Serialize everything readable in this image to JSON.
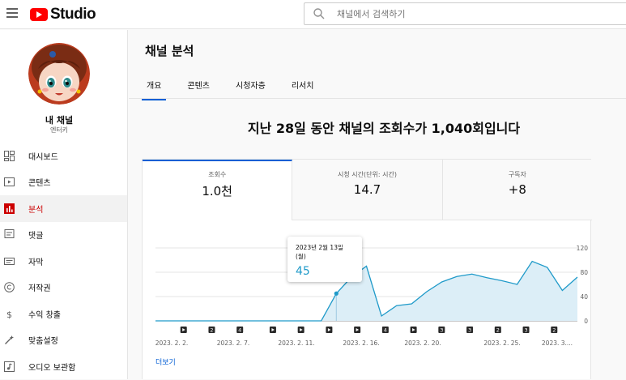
{
  "header": {
    "logo_text": "Studio",
    "search_placeholder": "채널에서 검색하기"
  },
  "sidebar": {
    "channel_name": "내 채널",
    "channel_sub": "엔터키",
    "items": [
      {
        "label": "대시보드",
        "icon": "dashboard-icon",
        "active": false
      },
      {
        "label": "콘텐츠",
        "icon": "content-icon",
        "active": false
      },
      {
        "label": "분석",
        "icon": "analytics-icon",
        "active": true
      },
      {
        "label": "댓글",
        "icon": "comments-icon",
        "active": false
      },
      {
        "label": "자막",
        "icon": "subtitles-icon",
        "active": false
      },
      {
        "label": "저작권",
        "icon": "copyright-icon",
        "active": false
      },
      {
        "label": "수익 창출",
        "icon": "monetization-icon",
        "active": false
      },
      {
        "label": "맞춤설정",
        "icon": "customization-icon",
        "active": false
      },
      {
        "label": "오디오 보관함",
        "icon": "audio-library-icon",
        "active": false
      }
    ]
  },
  "main": {
    "title": "채널 분석",
    "tabs": [
      {
        "label": "개요",
        "active": true
      },
      {
        "label": "콘텐츠",
        "active": false
      },
      {
        "label": "시청자층",
        "active": false
      },
      {
        "label": "리서치",
        "active": false
      }
    ],
    "headline": "지난 28일 동안 채널의 조회수가 1,040회입니다",
    "metrics": [
      {
        "label": "조회수",
        "value": "1.0천",
        "active": true
      },
      {
        "label": "시청 시간(단위: 시간)",
        "value": "14.7",
        "active": false
      },
      {
        "label": "구독자",
        "value": "+8",
        "active": false
      }
    ],
    "tooltip": {
      "date": "2023년 2월 13일 (월)",
      "value": "45"
    },
    "more_label": "더보기"
  },
  "colors": {
    "accent": "#065fd4",
    "chart_line": "#1f9ac9",
    "chart_fill": "#dceef7",
    "active_nav": "#cc0000"
  },
  "chart_data": {
    "type": "area",
    "x": [
      "2023. 2. 1.",
      "2023. 2. 2.",
      "2023. 2. 3.",
      "2023. 2. 4.",
      "2023. 2. 5.",
      "2023. 2. 6.",
      "2023. 2. 7.",
      "2023. 2. 8.",
      "2023. 2. 9.",
      "2023. 2. 10.",
      "2023. 2. 11.",
      "2023. 2. 12.",
      "2023. 2. 13.",
      "2023. 2. 14.",
      "2023. 2. 15.",
      "2023. 2. 16.",
      "2023. 2. 17.",
      "2023. 2. 18.",
      "2023. 2. 19.",
      "2023. 2. 20.",
      "2023. 2. 21.",
      "2023. 2. 22.",
      "2023. 2. 23.",
      "2023. 2. 24.",
      "2023. 2. 25.",
      "2023. 2. 26.",
      "2023. 2. 27.",
      "2023. 2. 28."
    ],
    "values": [
      0,
      0,
      0,
      0,
      0,
      0,
      0,
      0,
      0,
      0,
      0,
      0,
      45,
      72,
      90,
      8,
      25,
      28,
      48,
      64,
      73,
      77,
      71,
      66,
      60,
      98,
      88,
      50,
      72
    ],
    "ytick_labels": [
      "0",
      "40",
      "80",
      "120"
    ],
    "xtick_labels": [
      "2023. 2. 2.",
      "2023. 2. 7.",
      "2023. 2. 11.",
      "2023. 2. 16.",
      "2023. 2. 20.",
      "2023. 2. 25.",
      "2023. 3...."
    ],
    "ylim": [
      0,
      120
    ],
    "markers": [
      {
        "kind": "video",
        "label": ""
      },
      {
        "kind": "number",
        "label": "2"
      },
      {
        "kind": "number",
        "label": "4"
      },
      {
        "kind": "video",
        "label": ""
      },
      {
        "kind": "video",
        "label": ""
      },
      {
        "kind": "video",
        "label": ""
      },
      {
        "kind": "video",
        "label": ""
      },
      {
        "kind": "number",
        "label": "4"
      },
      {
        "kind": "video",
        "label": ""
      },
      {
        "kind": "number",
        "label": "3"
      },
      {
        "kind": "number",
        "label": "3"
      },
      {
        "kind": "number",
        "label": "2"
      },
      {
        "kind": "number",
        "label": "3"
      },
      {
        "kind": "number",
        "label": "2"
      }
    ],
    "grid": true
  }
}
